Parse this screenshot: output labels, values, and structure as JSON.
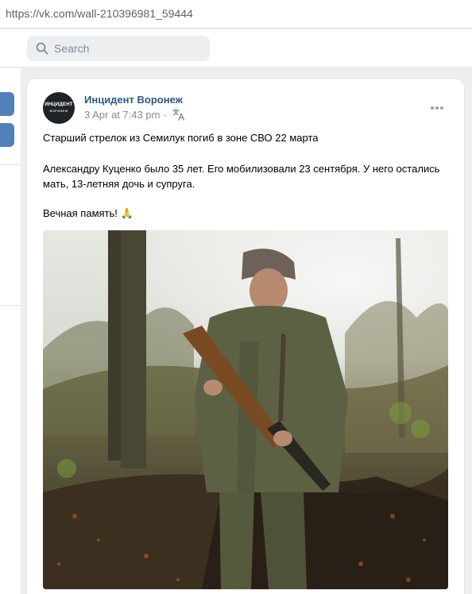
{
  "browser": {
    "url": "https://vk.com/wall-210396981_59444"
  },
  "header": {
    "search_placeholder": "Search"
  },
  "post": {
    "avatar": {
      "line1": "ИНЦИДЕНТ",
      "line2": "ВОРОНЕЖ"
    },
    "author": "Инцидент Воронеж",
    "date": "3 Apr at 7:43 pm",
    "separator": "·",
    "text": {
      "line1": "Старший стрелок из Семилук погиб в зоне СВО 22 марта",
      "line2": "Александру Куценко было 35 лет. Его мобилизовали 23 сентября. У него остались",
      "line3": "мать, 13-летняя дочь и супруга.",
      "line4": "Вечная память! 🙏"
    }
  },
  "icons": {
    "search": "search-icon",
    "translate": "translate-icon",
    "more": "more-options-icon"
  },
  "colors": {
    "link": "#2a5885",
    "accent": "#5181b8",
    "background": "#edeef0"
  }
}
